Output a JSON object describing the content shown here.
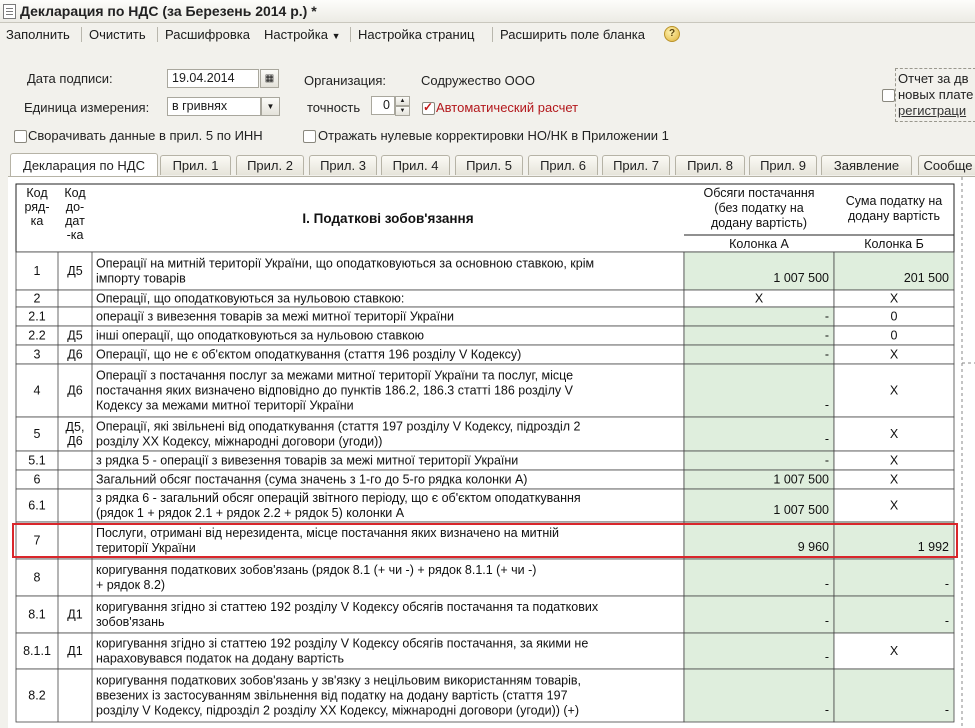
{
  "window": {
    "title": "Декларация по НДС (за Березень 2014 р.) *"
  },
  "toolbar": {
    "fill": "Заполнить",
    "clear": "Очистить",
    "decode": "Расшифровка",
    "settings": "Настройка",
    "page_setup": "Настройка страниц",
    "expand": "Расширить поле бланка",
    "help": "?"
  },
  "form": {
    "sign_date_label": "Дата подписи:",
    "sign_date_value": "19.04.2014",
    "unit_label": "Единица измерения:",
    "unit_value": "в гривнях",
    "org_label": "Организация:",
    "org_value": "Содружество ООО",
    "precision_label": "точность",
    "precision_value": "0",
    "auto_calc_label": "Автоматический расчет",
    "collapse_label": "Сворачивать данные в прил. 5 по ИНН",
    "zero_corr_label": "Отражать нулевые корректировки НО/НК в Приложении 1",
    "report_line1": "Отчет за дв",
    "report_line2": "новых плате",
    "report_line3": "регистраци"
  },
  "tabs": [
    "Декларация по НДС",
    "Прил. 1",
    "Прил. 2",
    "Прил. 3",
    "Прил. 4",
    "Прил. 5",
    "Прил. 6",
    "Прил. 7",
    "Прил. 8",
    "Прил. 9",
    "Заявление",
    "Сообще"
  ],
  "table": {
    "headers": {
      "code_row": [
        "Код",
        "ряд-",
        "ка"
      ],
      "code_app": [
        "Код",
        "до-",
        "дат",
        "-ка"
      ],
      "section": "І. Податкові зобов'язання",
      "colA": [
        "Обсяги постачання",
        "(без податку на",
        "додану вартість)"
      ],
      "colB": [
        "Сума податку на",
        "додану вартість"
      ],
      "colA_sub": "Колонка А",
      "colB_sub": "Колонка Б"
    },
    "rows": [
      {
        "code": "1",
        "app": [
          "Д5"
        ],
        "desc": [
          "Операції на митній території України, що оподатковуються за основною ставкою, крім",
          "імпорту товарів"
        ],
        "a": "1 007 500",
        "b": "201 500"
      },
      {
        "code": "2",
        "app": [],
        "desc": [
          "Операції, що оподатковуються за нульовою ставкою:"
        ],
        "a": "X",
        "b": "X"
      },
      {
        "code": "2.1",
        "app": [],
        "desc": [
          "операції з вивезення товарів за межі митної території України"
        ],
        "a": "-",
        "b": "0"
      },
      {
        "code": "2.2",
        "app": [
          "Д5"
        ],
        "desc": [
          "інші операції, що оподатковуються за нульовою ставкою"
        ],
        "a": "-",
        "b": "0"
      },
      {
        "code": "3",
        "app": [
          "Д6"
        ],
        "desc": [
          "Операції, що не є об'єктом оподаткування (стаття 196 розділу V Кодексу)"
        ],
        "a": "-",
        "b": "X"
      },
      {
        "code": "4",
        "app": [
          "Д6"
        ],
        "desc": [
          "Операції з постачання послуг за межами митної території України та послуг, місце",
          "постачання яких визначено відповідно до пунктів 186.2, 186.3 статті 186 розділу V",
          "Кодексу за межами митної території України"
        ],
        "a": "-",
        "b": "X"
      },
      {
        "code": "5",
        "app": [
          "Д5,",
          "Д6"
        ],
        "desc": [
          "Операції, які звільнені від оподаткування (стаття 197 розділу V Кодексу, підрозділ 2",
          "розділу XX Кодексу, міжнародні договори (угоди))"
        ],
        "a": "-",
        "b": "X"
      },
      {
        "code": "5.1",
        "app": [],
        "desc": [
          "з рядка 5 - операції з вивезення товарів за межі  митної території України"
        ],
        "a": "-",
        "b": "X"
      },
      {
        "code": "6",
        "app": [],
        "desc": [
          "Загальний обсяг постачання (сума значень з 1-го до 5-го рядка колонки А)"
        ],
        "a": "1 007 500",
        "b": "X"
      },
      {
        "code": "6.1",
        "app": [],
        "desc": [
          "з рядка 6 - загальний обсяг операцій звітного періоду, що є об'єктом оподаткування",
          "(рядок 1 + рядок 2.1 + рядок 2.2 + рядок 5) колонки А"
        ],
        "a": "1 007 500",
        "b": "X"
      },
      {
        "code": "7",
        "app": [],
        "desc": [
          "Послуги, отримані від нерезидента, місце постачання яких визначено на митній",
          "території України"
        ],
        "a": "9 960",
        "b": "1 992"
      },
      {
        "code": "8",
        "app": [],
        "desc": [
          "коригування податкових зобов'язань (рядок 8.1 (+ чи -) + рядок 8.1.1 (+ чи -)",
          "+ рядок 8.2)"
        ],
        "a": "-",
        "b": "-"
      },
      {
        "code": "8.1",
        "app": [
          "Д1"
        ],
        "desc": [
          "коригування згідно зі статтею 192 розділу V Кодексу обсягів постачання та податкових",
          "зобов'язань"
        ],
        "a": "-",
        "b": "-"
      },
      {
        "code": "8.1.1",
        "app": [
          "Д1"
        ],
        "desc": [
          "коригування згідно зі статтею 192 розділу V Кодексу обсягів постачання, за якими не",
          "нараховувався податок на додану вартість"
        ],
        "a": "-",
        "b": "X"
      },
      {
        "code": "8.2",
        "app": [],
        "desc": [
          "коригування податкових зобов'язань у зв'язку з нецільовим використанням товарів,",
          "ввезених із застосуванням звільнення від податку на додану вартість (стаття 197",
          "розділу V Кодексу, підрозділ 2 розділу XX Кодексу, міжнародні договори (угоди)) (+)"
        ],
        "a": "-",
        "b": "-"
      }
    ],
    "colors": {
      "green": "#dfeedd",
      "green_dark": "#c9e3c6",
      "highlight_border": "#d9262b"
    }
  }
}
